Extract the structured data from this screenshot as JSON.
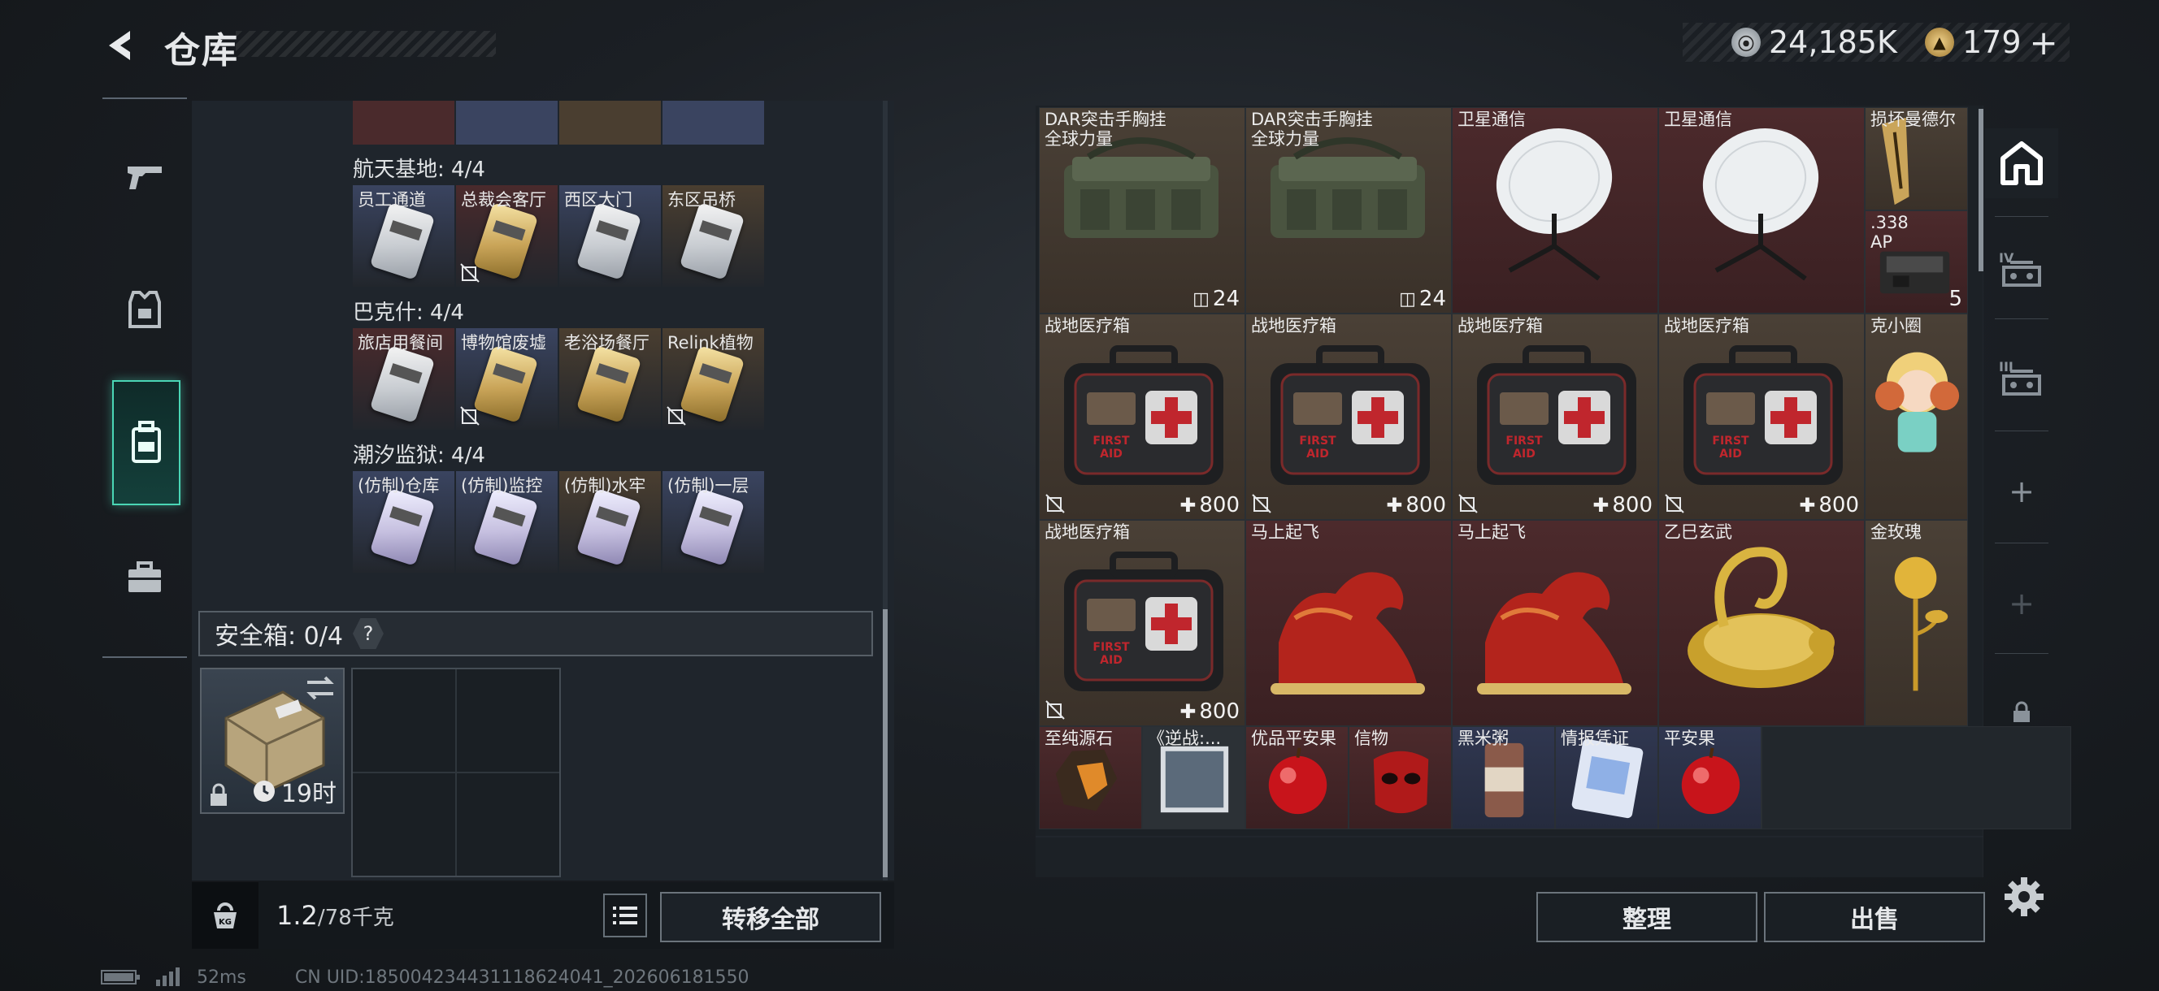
{
  "header": {
    "title": "仓库"
  },
  "currency": [
    {
      "icon": "silver-coin-icon",
      "value": "24,185K",
      "color": "#9fa6ad"
    },
    {
      "icon": "gold-triangle-coin-icon",
      "value": "179",
      "plus": "+",
      "color": "#c9a55a"
    }
  ],
  "nav": [
    {
      "icon": "pistol-icon",
      "active": false
    },
    {
      "icon": "armor-vest-icon",
      "active": false
    },
    {
      "icon": "backpack-icon",
      "active": true
    },
    {
      "icon": "briefcase-icon",
      "active": false
    }
  ],
  "collections": [
    {
      "label": "航天基地: 4/4",
      "cards": [
        {
          "name": "员工通道",
          "style": "silver",
          "bg": "#3a4460",
          "nolock": false
        },
        {
          "name": "总裁会客厅",
          "style": "gold",
          "bg": "#4a2a2c",
          "nolock": true
        },
        {
          "name": "西区大门",
          "style": "silver",
          "bg": "#3a4460",
          "nolock": false
        },
        {
          "name": "东区吊桥",
          "style": "silver",
          "bg": "#4a3e30",
          "nolock": false
        }
      ]
    },
    {
      "label": "巴克什: 4/4",
      "cards": [
        {
          "name": "旅店用餐间",
          "style": "silver",
          "bg": "#4a2a2c",
          "nolock": false
        },
        {
          "name": "博物馆废墟",
          "style": "gold",
          "bg": "#3a4460",
          "nolock": true
        },
        {
          "name": "老浴场餐厅",
          "style": "gold",
          "bg": "#4a3e30",
          "nolock": false
        },
        {
          "name": "Relink植物",
          "style": "gold",
          "bg": "#4a3e30",
          "nolock": true
        }
      ]
    },
    {
      "label": "潮汐监狱: 4/4",
      "cards": [
        {
          "name": "(仿制)仓库",
          "style": "violet",
          "bg": "#3a4460",
          "nolock": false
        },
        {
          "name": "(仿制)监控",
          "style": "violet",
          "bg": "#3a4460",
          "nolock": false
        },
        {
          "name": "(仿制)水牢",
          "style": "violet",
          "bg": "#4a3e30",
          "nolock": false
        },
        {
          "name": "(仿制)一层",
          "style": "violet",
          "bg": "#3a4460",
          "nolock": false
        }
      ]
    }
  ],
  "safebox": {
    "label": "安全箱: 0/4",
    "help": "?",
    "timer": "19时"
  },
  "footer": {
    "weight": "1.2",
    "weight_max": "/78千克",
    "transfer_label": "转移全部"
  },
  "items": [
    {
      "name": "DAR突击手胸挂\n全球力量",
      "bg": "brown",
      "count": "24",
      "countIcon": "vest",
      "art": "bag",
      "col": 0,
      "row": 0,
      "w": 1,
      "h": 1
    },
    {
      "name": "DAR突击手胸挂\n全球力量",
      "bg": "brown",
      "count": "24",
      "countIcon": "vest",
      "art": "bag",
      "col": 1,
      "row": 0,
      "w": 1,
      "h": 1
    },
    {
      "name": "卫星通信",
      "bg": "red",
      "count": "",
      "art": "dish",
      "col": 2,
      "row": 0,
      "w": 1,
      "h": 1
    },
    {
      "name": "卫星通信",
      "bg": "red",
      "count": "",
      "art": "dish",
      "col": 3,
      "row": 0,
      "w": 1,
      "h": 1
    },
    {
      "name": "损坏曼德尔",
      "bg": "brown",
      "count": "",
      "art": "gold-brick",
      "col": 4,
      "row": 0,
      "w": 0.5,
      "h": 0.5
    },
    {
      "name": ".338\nAP",
      "bg": "red",
      "count": "5",
      "art": "ammo",
      "col": 4,
      "row": 0.5,
      "w": 0.5,
      "h": 0.5
    },
    {
      "name": "战地医疗箱",
      "bg": "brown",
      "count": "800",
      "countIcon": "plus",
      "art": "medkit",
      "nolock": true,
      "col": 0,
      "row": 1,
      "w": 1,
      "h": 1
    },
    {
      "name": "战地医疗箱",
      "bg": "brown",
      "count": "800",
      "countIcon": "plus",
      "art": "medkit",
      "nolock": true,
      "col": 1,
      "row": 1,
      "w": 1,
      "h": 1
    },
    {
      "name": "战地医疗箱",
      "bg": "brown",
      "count": "800",
      "countIcon": "plus",
      "art": "medkit",
      "nolock": true,
      "col": 2,
      "row": 1,
      "w": 1,
      "h": 1
    },
    {
      "name": "战地医疗箱",
      "bg": "brown",
      "count": "800",
      "countIcon": "plus",
      "art": "medkit",
      "nolock": true,
      "col": 3,
      "row": 1,
      "w": 1,
      "h": 1
    },
    {
      "name": "克小圈",
      "bg": "brown",
      "count": "",
      "art": "doll",
      "col": 4,
      "row": 1,
      "w": 0.5,
      "h": 1
    },
    {
      "name": "战地医疗箱",
      "bg": "brown",
      "count": "800",
      "countIcon": "plus",
      "art": "medkit",
      "nolock": true,
      "col": 0,
      "row": 2,
      "w": 1,
      "h": 1
    },
    {
      "name": "马上起飞",
      "bg": "red",
      "count": "",
      "art": "horse",
      "col": 1,
      "row": 2,
      "w": 1,
      "h": 1
    },
    {
      "name": "马上起飞",
      "bg": "red",
      "count": "",
      "art": "horse",
      "col": 2,
      "row": 2,
      "w": 1,
      "h": 1
    },
    {
      "name": "乙巳玄武",
      "bg": "red",
      "count": "",
      "art": "turtle",
      "col": 3,
      "row": 2,
      "w": 1,
      "h": 1
    },
    {
      "name": "金玫瑰",
      "bg": "brown",
      "count": "",
      "art": "rose",
      "col": 4,
      "row": 2,
      "w": 0.5,
      "h": 1
    },
    {
      "name": "至纯源石",
      "bg": "red",
      "count": "",
      "art": "stone",
      "col": 0,
      "row": 3,
      "w": 0.5,
      "h": 0.5
    },
    {
      "name": "《逆战:...",
      "bg": "gray",
      "count": "",
      "art": "book",
      "col": 0.5,
      "row": 3,
      "w": 0.5,
      "h": 0.5
    },
    {
      "name": "优品平安果",
      "bg": "red",
      "count": "",
      "art": "apple",
      "col": 1,
      "row": 3,
      "w": 0.5,
      "h": 0.5
    },
    {
      "name": "信物",
      "bg": "red",
      "count": "",
      "art": "mask",
      "col": 1.5,
      "row": 3,
      "w": 0.5,
      "h": 0.5
    },
    {
      "name": "黑米粥",
      "bg": "navy",
      "count": "",
      "art": "can",
      "col": 2,
      "row": 3,
      "w": 0.5,
      "h": 0.5
    },
    {
      "name": "情报凭证",
      "bg": "navy",
      "count": "",
      "art": "ticket",
      "col": 2.5,
      "row": 3,
      "w": 0.5,
      "h": 0.5
    },
    {
      "name": "平安果",
      "bg": "navy",
      "count": "",
      "art": "apple",
      "col": 3,
      "row": 3,
      "w": 0.5,
      "h": 0.5
    }
  ],
  "right_nav": [
    {
      "icon": "storage-home-icon",
      "label": ""
    },
    {
      "icon": "vest-tier-4-icon",
      "label": "IV"
    },
    {
      "icon": "vest-tier-3-icon",
      "label": "III"
    },
    {
      "icon": "add-icon",
      "label": "+"
    },
    {
      "icon": "add-icon-dim",
      "label": "+"
    },
    {
      "icon": "lock-icon",
      "label": ""
    }
  ],
  "actions": {
    "sort_label": "整理",
    "sell_label": "出售"
  },
  "status": {
    "ping": "52ms",
    "uid": "CN UID:1850042344311186240​41_202606181550"
  }
}
